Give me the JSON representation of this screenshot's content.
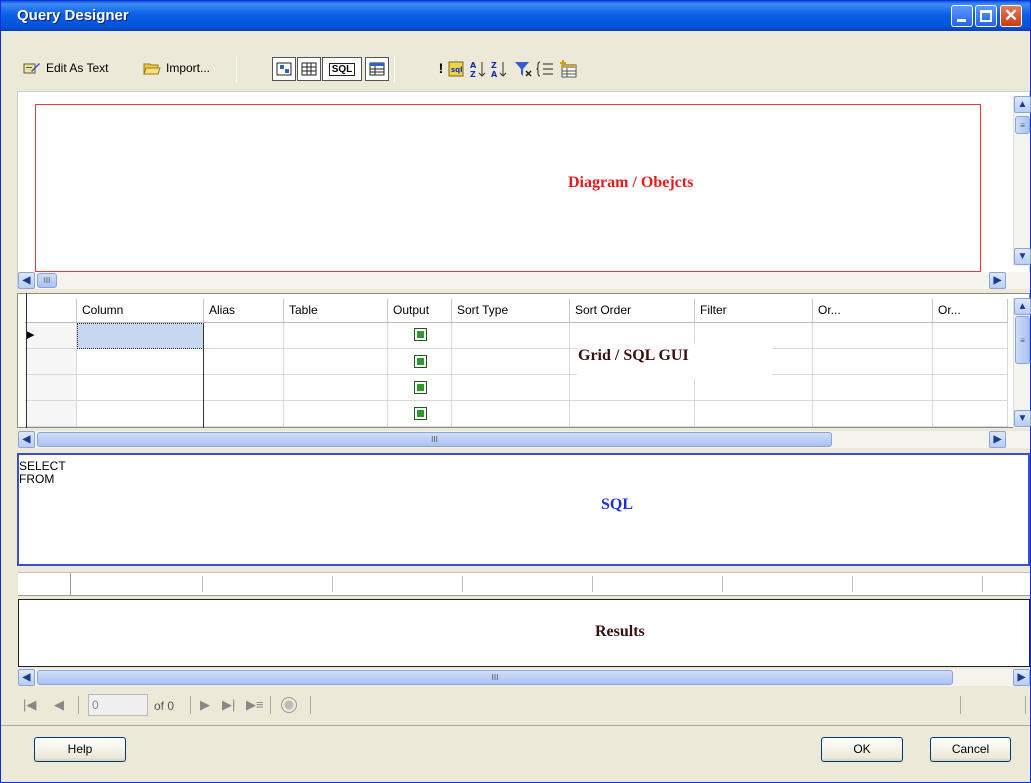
{
  "window": {
    "title": "Query Designer"
  },
  "toolbar": {
    "edit_as_text": "Edit As Text",
    "import": "Import..."
  },
  "diagram": {
    "label": "Diagram / Obejcts"
  },
  "grid": {
    "label": "Grid / SQL GUI",
    "columns": [
      "Column",
      "Alias",
      "Table",
      "Output",
      "Sort Type",
      "Sort Order",
      "Filter",
      "Or...",
      "Or..."
    ]
  },
  "sql": {
    "line1": "SELECT",
    "line2": "FROM",
    "label": "SQL"
  },
  "results": {
    "label": "Results"
  },
  "navigator": {
    "record_value": "0",
    "of_text": "of 0"
  },
  "buttons": {
    "help": "Help",
    "ok": "OK",
    "cancel": "Cancel"
  }
}
